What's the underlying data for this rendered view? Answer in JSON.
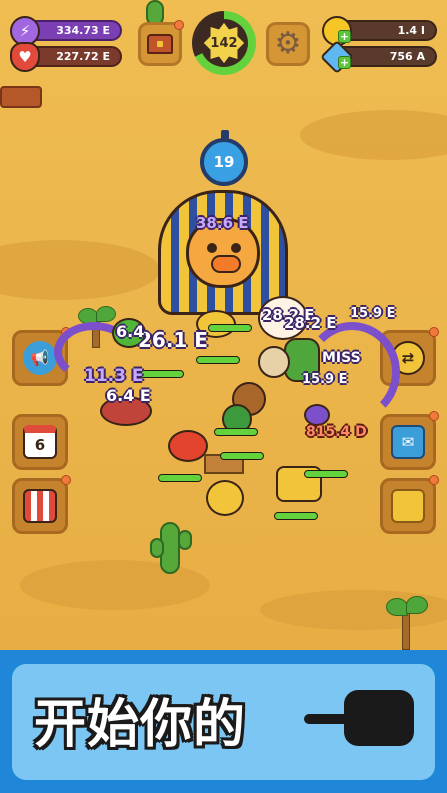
{
  "hud": {
    "energy": "334.73 E",
    "health": "227.72 E",
    "level": "142",
    "level_progress": 0.68,
    "coins": "1.4 I",
    "gems": "756 A"
  },
  "boss": {
    "timer": "19",
    "damage": "38.6 E"
  },
  "side_buttons": {
    "calendar_day": "6"
  },
  "damage_numbers": [
    {
      "text": "26.1 E",
      "style": "white"
    },
    {
      "text": "11.3 E",
      "style": "purple"
    },
    {
      "text": "6.4 E",
      "style": "white"
    },
    {
      "text": "6.4",
      "style": "white"
    },
    {
      "text": "28.2 E",
      "style": "white"
    },
    {
      "text": "28.2 E",
      "style": "white"
    },
    {
      "text": "15.9 E",
      "style": "white"
    },
    {
      "text": "MISS",
      "style": "white"
    },
    {
      "text": "15.9 E",
      "style": "white"
    },
    {
      "text": "815.4 D",
      "style": "red"
    }
  ],
  "banner": {
    "title": "开始你的"
  },
  "colors": {
    "sand": "#efbd52",
    "banner_blue": "#1f86d8",
    "hp_green": "#64d23c",
    "worm_purple": "#7c4fcb"
  }
}
